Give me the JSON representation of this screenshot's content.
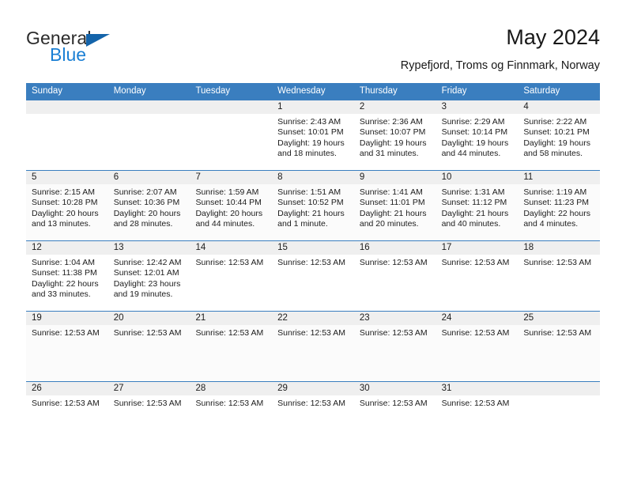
{
  "logo": {
    "word_one": "General",
    "word_two": "Blue",
    "triangle_color": "#1464aa",
    "blue_color": "#1a7fd4"
  },
  "header": {
    "title": "May 2024",
    "subtitle": "Rypefjord, Troms og Finnmark, Norway"
  },
  "theme": {
    "header_row_bg": "#3a7ebf",
    "date_strip_bg": "#efefef",
    "row_border": "#3a7ebf"
  },
  "weekdays": [
    "Sunday",
    "Monday",
    "Tuesday",
    "Wednesday",
    "Thursday",
    "Friday",
    "Saturday"
  ],
  "weeks": [
    {
      "shaded": false,
      "days": [
        {
          "date": "",
          "lines": []
        },
        {
          "date": "",
          "lines": []
        },
        {
          "date": "",
          "lines": []
        },
        {
          "date": "1",
          "lines": [
            "Sunrise: 2:43 AM",
            "Sunset: 10:01 PM",
            "Daylight: 19 hours and 18 minutes."
          ]
        },
        {
          "date": "2",
          "lines": [
            "Sunrise: 2:36 AM",
            "Sunset: 10:07 PM",
            "Daylight: 19 hours and 31 minutes."
          ]
        },
        {
          "date": "3",
          "lines": [
            "Sunrise: 2:29 AM",
            "Sunset: 10:14 PM",
            "Daylight: 19 hours and 44 minutes."
          ]
        },
        {
          "date": "4",
          "lines": [
            "Sunrise: 2:22 AM",
            "Sunset: 10:21 PM",
            "Daylight: 19 hours and 58 minutes."
          ]
        }
      ]
    },
    {
      "shaded": true,
      "days": [
        {
          "date": "5",
          "lines": [
            "Sunrise: 2:15 AM",
            "Sunset: 10:28 PM",
            "Daylight: 20 hours and 13 minutes."
          ]
        },
        {
          "date": "6",
          "lines": [
            "Sunrise: 2:07 AM",
            "Sunset: 10:36 PM",
            "Daylight: 20 hours and 28 minutes."
          ]
        },
        {
          "date": "7",
          "lines": [
            "Sunrise: 1:59 AM",
            "Sunset: 10:44 PM",
            "Daylight: 20 hours and 44 minutes."
          ]
        },
        {
          "date": "8",
          "lines": [
            "Sunrise: 1:51 AM",
            "Sunset: 10:52 PM",
            "Daylight: 21 hours and 1 minute."
          ]
        },
        {
          "date": "9",
          "lines": [
            "Sunrise: 1:41 AM",
            "Sunset: 11:01 PM",
            "Daylight: 21 hours and 20 minutes."
          ]
        },
        {
          "date": "10",
          "lines": [
            "Sunrise: 1:31 AM",
            "Sunset: 11:12 PM",
            "Daylight: 21 hours and 40 minutes."
          ]
        },
        {
          "date": "11",
          "lines": [
            "Sunrise: 1:19 AM",
            "Sunset: 11:23 PM",
            "Daylight: 22 hours and 4 minutes."
          ]
        }
      ]
    },
    {
      "shaded": false,
      "days": [
        {
          "date": "12",
          "lines": [
            "Sunrise: 1:04 AM",
            "Sunset: 11:38 PM",
            "Daylight: 22 hours and 33 minutes."
          ]
        },
        {
          "date": "13",
          "lines": [
            "Sunrise: 12:42 AM",
            "Sunset: 12:01 AM",
            "Daylight: 23 hours and 19 minutes."
          ]
        },
        {
          "date": "14",
          "lines": [
            "Sunrise: 12:53 AM"
          ]
        },
        {
          "date": "15",
          "lines": [
            "Sunrise: 12:53 AM"
          ]
        },
        {
          "date": "16",
          "lines": [
            "Sunrise: 12:53 AM"
          ]
        },
        {
          "date": "17",
          "lines": [
            "Sunrise: 12:53 AM"
          ]
        },
        {
          "date": "18",
          "lines": [
            "Sunrise: 12:53 AM"
          ]
        }
      ]
    },
    {
      "shaded": true,
      "days": [
        {
          "date": "19",
          "lines": [
            "Sunrise: 12:53 AM"
          ]
        },
        {
          "date": "20",
          "lines": [
            "Sunrise: 12:53 AM"
          ]
        },
        {
          "date": "21",
          "lines": [
            "Sunrise: 12:53 AM"
          ]
        },
        {
          "date": "22",
          "lines": [
            "Sunrise: 12:53 AM"
          ]
        },
        {
          "date": "23",
          "lines": [
            "Sunrise: 12:53 AM"
          ]
        },
        {
          "date": "24",
          "lines": [
            "Sunrise: 12:53 AM"
          ]
        },
        {
          "date": "25",
          "lines": [
            "Sunrise: 12:53 AM"
          ]
        }
      ]
    },
    {
      "shaded": false,
      "days": [
        {
          "date": "26",
          "lines": [
            "Sunrise: 12:53 AM"
          ]
        },
        {
          "date": "27",
          "lines": [
            "Sunrise: 12:53 AM"
          ]
        },
        {
          "date": "28",
          "lines": [
            "Sunrise: 12:53 AM"
          ]
        },
        {
          "date": "29",
          "lines": [
            "Sunrise: 12:53 AM"
          ]
        },
        {
          "date": "30",
          "lines": [
            "Sunrise: 12:53 AM"
          ]
        },
        {
          "date": "31",
          "lines": [
            "Sunrise: 12:53 AM"
          ]
        },
        {
          "date": "",
          "lines": []
        }
      ]
    }
  ]
}
